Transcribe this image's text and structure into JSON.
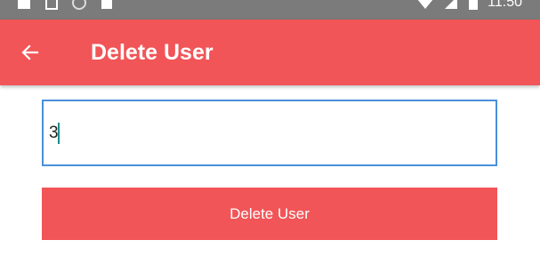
{
  "status_bar": {
    "time": "11:50",
    "left_icons": [
      "notification-icon",
      "sim-icon",
      "sync-icon",
      "download-icon"
    ],
    "right_icons": [
      "wifi-icon",
      "signal-icon",
      "battery-icon"
    ]
  },
  "app_bar": {
    "title": "Delete User",
    "back_icon": "back-arrow-icon",
    "color": "#f15558"
  },
  "form": {
    "user_id_value": "3",
    "delete_button_label": "Delete User",
    "input_border_color": "#4a90d9"
  }
}
